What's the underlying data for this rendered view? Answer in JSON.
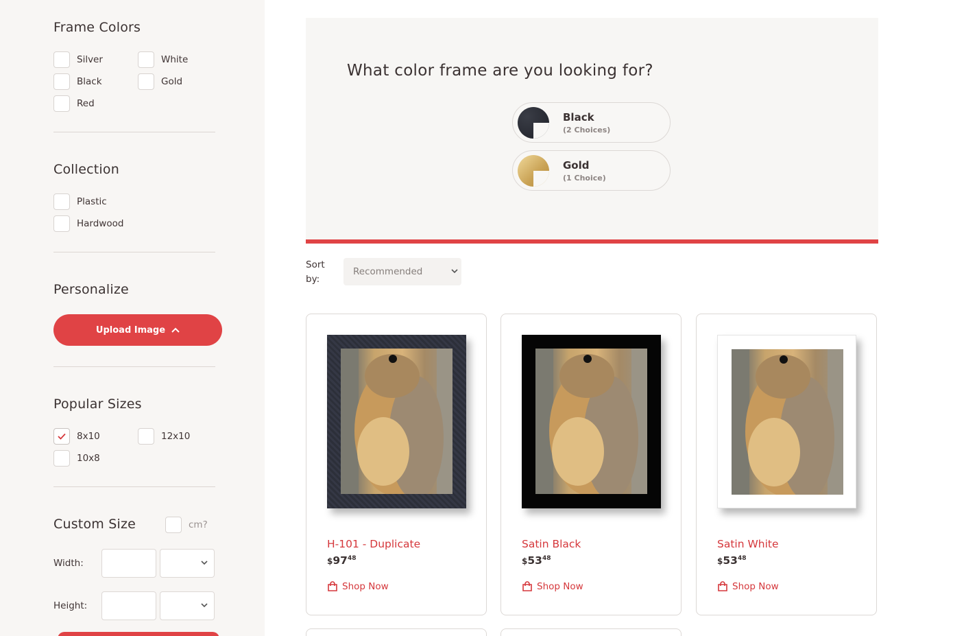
{
  "sidebar": {
    "frame_colors": {
      "title": "Frame Colors",
      "options": [
        {
          "label": "Silver",
          "checked": false
        },
        {
          "label": "White",
          "checked": false
        },
        {
          "label": "Black",
          "checked": false
        },
        {
          "label": "Gold",
          "checked": false
        },
        {
          "label": "Red",
          "checked": false
        }
      ]
    },
    "collection": {
      "title": "Collection",
      "options": [
        {
          "label": "Plastic",
          "checked": false
        },
        {
          "label": "Hardwood",
          "checked": false
        }
      ]
    },
    "personalize": {
      "title": "Personalize",
      "upload_label": "Upload Image"
    },
    "popular_sizes": {
      "title": "Popular Sizes",
      "options": [
        {
          "label": "8x10",
          "checked": true
        },
        {
          "label": "12x10",
          "checked": false
        },
        {
          "label": "10x8",
          "checked": false
        }
      ]
    },
    "custom_size": {
      "title": "Custom Size",
      "cm_label": "cm?",
      "cm_checked": false,
      "width_label": "Width:",
      "height_label": "Height:"
    }
  },
  "banner": {
    "question": "What color frame are you looking for?",
    "choices": [
      {
        "name": "Black",
        "count": "(2 Choices)"
      },
      {
        "name": "Gold",
        "count": "(1 Choice)"
      }
    ]
  },
  "sort": {
    "label": "Sort by:",
    "selected": "Recommended"
  },
  "products": [
    {
      "title": "H-101 - Duplicate",
      "currency": "$",
      "price_whole": "97",
      "price_cents": "48",
      "shop_label": "Shop Now"
    },
    {
      "title": "Satin Black",
      "currency": "$",
      "price_whole": "53",
      "price_cents": "48",
      "shop_label": "Shop Now"
    },
    {
      "title": "Satin White",
      "currency": "$",
      "price_whole": "53",
      "price_cents": "48",
      "shop_label": "Shop Now"
    }
  ],
  "colors": {
    "accent": "#e04345",
    "link": "#d5373b",
    "sidebar_bg": "#f8f6f4",
    "banner_bg": "#f7f6f4"
  }
}
